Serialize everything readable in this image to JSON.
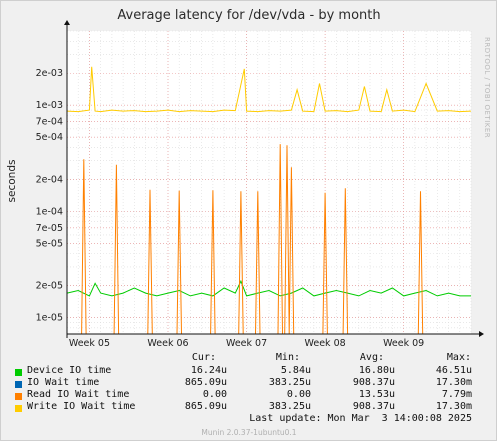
{
  "colors": {
    "device_io": "#00cc00",
    "io_wait": "#0066b3",
    "read_io_wait": "#ff8000",
    "write_io_wait": "#ffcc00",
    "grid_major": "#e89090",
    "grid_minor": "#dcdcdc",
    "plot_bg": "#ffffff",
    "frame_bg": "#f0f0f0"
  },
  "side_text": "RRDTOOL / TOBI OETIKER",
  "footer": "Munin 2.0.37-1ubuntu0.1",
  "legend": {
    "headers": [
      "Cur:",
      "Min:",
      "Avg:",
      "Max:"
    ],
    "rows": [
      {
        "label": "Device IO time",
        "color": "#00cc00",
        "cur": "16.24u",
        "min": "5.84u",
        "avg": "16.80u",
        "max": "46.51u"
      },
      {
        "label": "IO Wait time",
        "color": "#0066b3",
        "cur": "865.09u",
        "min": "383.25u",
        "avg": "908.37u",
        "max": "17.30m"
      },
      {
        "label": "Read IO Wait time",
        "color": "#ff8000",
        "cur": "0.00",
        "min": "0.00",
        "avg": "13.53u",
        "max": "7.79m"
      },
      {
        "label": "Write IO Wait time",
        "color": "#ffcc00",
        "cur": "865.09u",
        "min": "383.25u",
        "avg": "908.37u",
        "max": "17.30m"
      }
    ],
    "last_update": "Last update: Mon Mar  3 14:00:08 2025"
  },
  "chart_data": {
    "type": "line",
    "title": "Average latency for /dev/vda - by month",
    "ylabel": "seconds",
    "xlabel": "",
    "y_scale": "log",
    "ylim": [
      7e-06,
      0.005
    ],
    "yticks": [
      {
        "v": 1e-05,
        "label": "1e-05"
      },
      {
        "v": 2e-05,
        "label": "2e-05"
      },
      {
        "v": 5e-05,
        "label": "5e-05"
      },
      {
        "v": 7e-05,
        "label": "7e-05"
      },
      {
        "v": 0.0001,
        "label": "1e-04"
      },
      {
        "v": 0.0002,
        "label": "2e-04"
      },
      {
        "v": 0.0005,
        "label": "5e-04"
      },
      {
        "v": 0.0007,
        "label": "7e-04"
      },
      {
        "v": 0.001,
        "label": "1e-03"
      },
      {
        "v": 0.002,
        "label": "2e-03"
      }
    ],
    "x_range": [
      0,
      36
    ],
    "xticks": [
      {
        "v": 2.0,
        "label": "Week 05"
      },
      {
        "v": 9.0,
        "label": "Week 06"
      },
      {
        "v": 16.0,
        "label": "Week 07"
      },
      {
        "v": 23.0,
        "label": "Week 08"
      },
      {
        "v": 30.0,
        "label": "Week 09"
      }
    ],
    "series": [
      {
        "name": "Device IO time",
        "color": "#00cc00",
        "x": [
          0,
          1,
          2,
          2.5,
          3,
          4,
          5,
          6,
          7,
          8,
          9,
          10,
          11,
          12,
          13,
          14,
          15,
          15.5,
          16,
          17,
          18,
          19,
          20,
          21,
          22,
          23,
          24,
          25,
          26,
          27,
          28,
          29,
          30,
          31,
          32,
          33,
          34,
          35,
          36
        ],
        "y": [
          1.7e-05,
          1.8e-05,
          1.6e-05,
          2.1e-05,
          1.7e-05,
          1.6e-05,
          1.7e-05,
          1.9e-05,
          1.7e-05,
          1.6e-05,
          1.7e-05,
          1.8e-05,
          1.6e-05,
          1.7e-05,
          1.6e-05,
          1.9e-05,
          1.7e-05,
          2.2e-05,
          1.6e-05,
          1.7e-05,
          1.8e-05,
          1.6e-05,
          1.7e-05,
          1.9e-05,
          1.6e-05,
          1.7e-05,
          1.8e-05,
          1.7e-05,
          1.6e-05,
          1.8e-05,
          1.7e-05,
          1.9e-05,
          1.6e-05,
          1.7e-05,
          1.8e-05,
          1.6e-05,
          1.7e-05,
          1.6e-05,
          1.6e-05
        ]
      },
      {
        "name": "Read IO Wait time",
        "color": "#ff8000",
        "x": [
          1.3,
          1.5,
          1.7,
          4.2,
          4.4,
          4.6,
          7.2,
          7.4,
          7.6,
          9.8,
          10.0,
          10.2,
          12.8,
          13.0,
          13.2,
          15.3,
          15.5,
          15.7,
          16.8,
          17.0,
          17.2,
          18.8,
          19.0,
          19.2,
          19.4,
          19.6,
          19.8,
          20.0,
          20.2,
          22.8,
          23.0,
          23.2,
          24.6,
          24.8,
          25.0,
          31.3,
          31.5,
          31.7
        ],
        "y": [
          7e-06,
          0.00031,
          7e-06,
          7e-06,
          0.000275,
          7e-06,
          7e-06,
          0.00016,
          7e-06,
          7e-06,
          0.000157,
          7e-06,
          7e-06,
          0.000158,
          7e-06,
          7e-06,
          0.000155,
          7e-06,
          7e-06,
          0.000155,
          7e-06,
          7e-06,
          0.00043,
          7e-06,
          7e-06,
          0.00042,
          7e-06,
          0.00026,
          7e-06,
          7e-06,
          0.00015,
          7e-06,
          7e-06,
          0.000165,
          7e-06,
          7e-06,
          0.000155,
          7e-06
        ]
      },
      {
        "name": "Write IO Wait time",
        "color": "#ffcc00",
        "x": [
          0,
          1,
          2,
          2.2,
          2.5,
          3,
          4,
          5,
          6,
          7,
          8,
          9,
          10,
          11,
          12,
          13,
          14,
          15,
          15.8,
          16,
          17,
          18,
          19,
          20,
          20.5,
          21,
          22,
          22.5,
          23,
          24,
          25,
          26,
          26.5,
          27,
          28,
          28.5,
          29,
          30,
          31,
          32,
          33,
          34,
          35,
          36
        ],
        "y": [
          0.00088,
          0.00087,
          0.0009,
          0.0023,
          0.00088,
          0.00087,
          0.0009,
          0.00088,
          0.00089,
          0.00087,
          0.00088,
          0.0009,
          0.00087,
          0.00089,
          0.00088,
          0.00087,
          0.0009,
          0.00089,
          0.0022,
          0.00088,
          0.00087,
          0.00089,
          0.00088,
          0.0009,
          0.0014,
          0.00088,
          0.00087,
          0.0016,
          0.00088,
          0.00089,
          0.00087,
          0.0009,
          0.0015,
          0.00088,
          0.00087,
          0.0014,
          0.00088,
          0.0009,
          0.00087,
          0.0016,
          0.00088,
          0.00089,
          0.00087,
          0.00088
        ]
      }
    ]
  }
}
